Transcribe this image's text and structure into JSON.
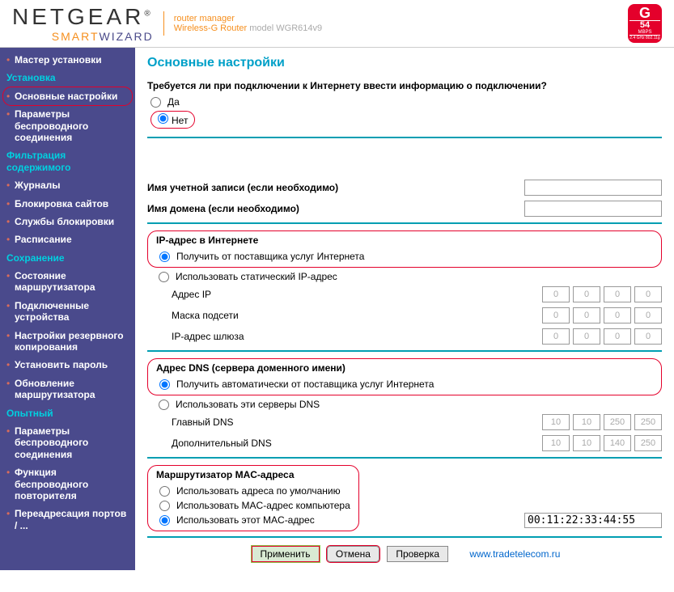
{
  "header": {
    "brand": "NETGEAR",
    "smart": "SMART",
    "wizard": "WIZARD",
    "manager": "router manager",
    "product": "Wireless-G Router ",
    "model": "model WGR614v9",
    "badge_g": "G",
    "badge_54": "54",
    "badge_mbps": "MBPS",
    "badge_sub": "2.4 GHz 802.11g"
  },
  "nav": {
    "master": "Мастер установки",
    "h_install": "Установка",
    "basic": "Основные настройки",
    "wireless": "Параметры беспроводного соединения",
    "h_filter": "Фильтрация содержимого",
    "logs": "Журналы",
    "block_sites": "Блокировка сайтов",
    "block_svc": "Службы блокировки",
    "schedule": "Расписание",
    "h_maint": "Сохранение",
    "router_status": "Состояние маршрутизатора",
    "attached": "Подключенные устройства",
    "backup": "Настройки резервного копирования",
    "set_pass": "Установить пароль",
    "upgrade": "Обновление маршрутизатора",
    "h_adv": "Опытный",
    "adv_wireless": "Параметры беспроводного соединения",
    "repeater": "Функция беспроводного повторителя",
    "port_fwd": "Переадресация портов / ..."
  },
  "page": {
    "title": "Основные настройки",
    "q_login": "Требуется ли при подключении к Интернету ввести информацию о подключении?",
    "yes": "Да",
    "no": "Нет",
    "account": "Имя учетной записи  (если необходимо)",
    "domain": "Имя домена  (если необходимо)",
    "ip_section": "IP-адрес в Интернете",
    "ip_auto": "Получить от поставщика услуг Интернета",
    "ip_static": "Использовать статический IP-адрес",
    "ip_addr": "Адрес IP",
    "ip_mask": "Маска подсети",
    "ip_gw": "IP-адрес шлюза",
    "dns_section": "Адрес DNS (сервера доменного имени)",
    "dns_auto": "Получить автоматически от поставщика услуг Интернета",
    "dns_manual": "Использовать эти серверы DNS",
    "dns_primary": "Главный DNS",
    "dns_secondary": "Дополнительный DNS",
    "mac_section": "Маршрутизатор MAC-адреса",
    "mac_default": "Использовать адреса по умолчанию",
    "mac_pc": "Использовать MAC-адрес компьютера",
    "mac_this": "Использовать этот MAC-адрес",
    "mac_value": "00:11:22:33:44:55",
    "btn_apply": "Применить",
    "btn_cancel": "Отмена",
    "btn_test": "Проверка",
    "link": "www.tradetelecom.ru",
    "ip_vals": {
      "addr": [
        "0",
        "0",
        "0",
        "0"
      ],
      "mask": [
        "0",
        "0",
        "0",
        "0"
      ],
      "gw": [
        "0",
        "0",
        "0",
        "0"
      ]
    },
    "dns_vals": {
      "p": [
        "10",
        "10",
        "250",
        "250"
      ],
      "s": [
        "10",
        "10",
        "140",
        "250"
      ]
    }
  }
}
